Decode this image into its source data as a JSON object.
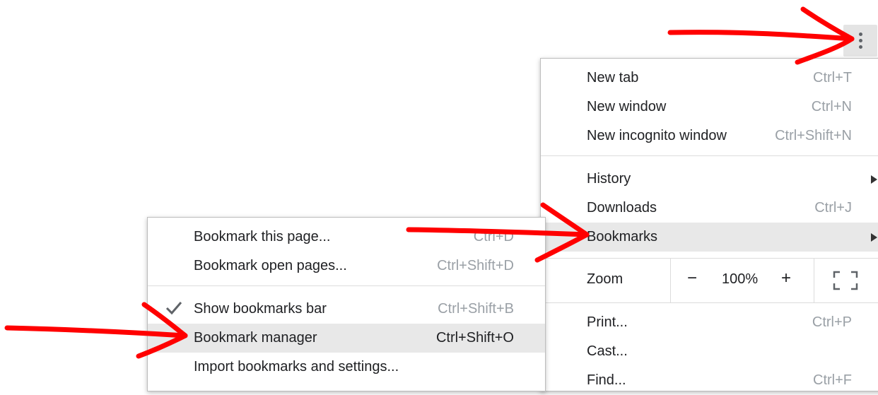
{
  "menu_button": {
    "icon": "more-vert-icon"
  },
  "main_menu": {
    "new_tab": {
      "label": "New tab",
      "shortcut": "Ctrl+T"
    },
    "new_window": {
      "label": "New window",
      "shortcut": "Ctrl+N"
    },
    "new_incognito": {
      "label": "New incognito window",
      "shortcut": "Ctrl+Shift+N"
    },
    "history": {
      "label": "History"
    },
    "downloads": {
      "label": "Downloads",
      "shortcut": "Ctrl+J"
    },
    "bookmarks": {
      "label": "Bookmarks"
    },
    "zoom": {
      "label": "Zoom",
      "minus": "−",
      "value": "100%",
      "plus": "+"
    },
    "print": {
      "label": "Print...",
      "shortcut": "Ctrl+P"
    },
    "cast": {
      "label": "Cast..."
    },
    "find": {
      "label": "Find...",
      "shortcut": "Ctrl+F"
    }
  },
  "bookmarks_submenu": {
    "bookmark_page": {
      "label": "Bookmark this page...",
      "shortcut": "Ctrl+D"
    },
    "bookmark_open_pages": {
      "label": "Bookmark open pages...",
      "shortcut": "Ctrl+Shift+D"
    },
    "show_bar": {
      "label": "Show bookmarks bar",
      "shortcut": "Ctrl+Shift+B",
      "checked": true
    },
    "manager": {
      "label": "Bookmark manager",
      "shortcut": "Ctrl+Shift+O"
    },
    "import": {
      "label": "Import bookmarks and settings..."
    }
  },
  "colors": {
    "annotation_arrow": "#ff0000",
    "highlight": "#e8e8e8",
    "shortcut_text": "#9aa0a6"
  }
}
